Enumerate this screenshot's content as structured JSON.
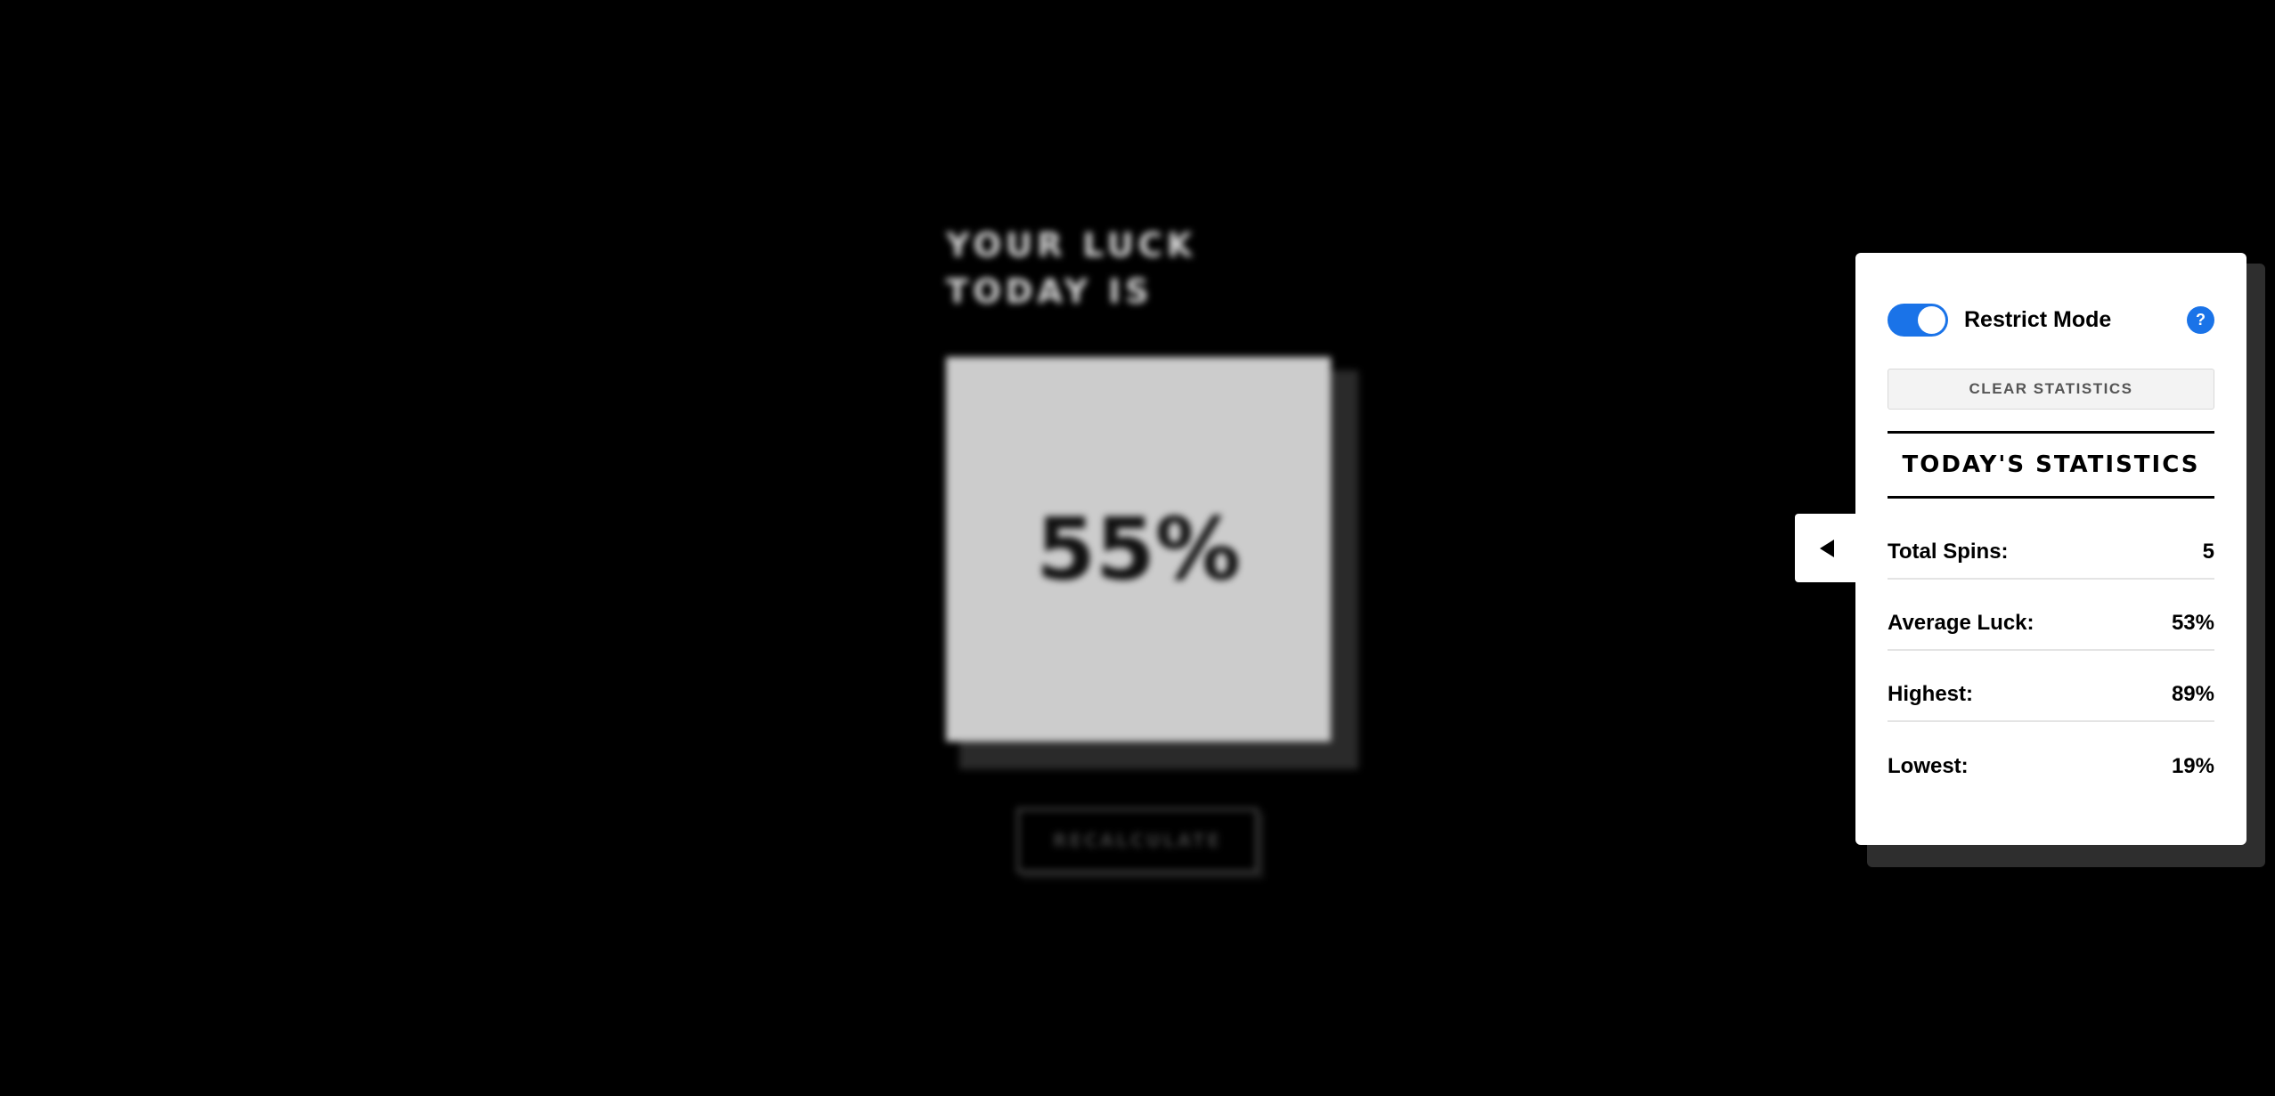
{
  "main": {
    "heading": "YOUR LUCK TODAY IS",
    "luck_value": "55%",
    "recalculate_label": "RECALCULATE"
  },
  "panel": {
    "collapse_icon": "triangle-left-icon",
    "restrict_mode": {
      "label": "Restrict Mode",
      "enabled": true,
      "help_icon": "?"
    },
    "clear_label": "CLEAR STATISTICS",
    "stats_title": "TODAY'S STATISTICS",
    "stats": [
      {
        "label": "Total Spins:",
        "value": "5"
      },
      {
        "label": "Average Luck:",
        "value": "53%"
      },
      {
        "label": "Highest:",
        "value": "89%"
      },
      {
        "label": "Lowest:",
        "value": "19%"
      }
    ]
  },
  "colors": {
    "background": "#000000",
    "accent": "#1a73e8",
    "card": "#cccccc",
    "panel": "#ffffff"
  }
}
